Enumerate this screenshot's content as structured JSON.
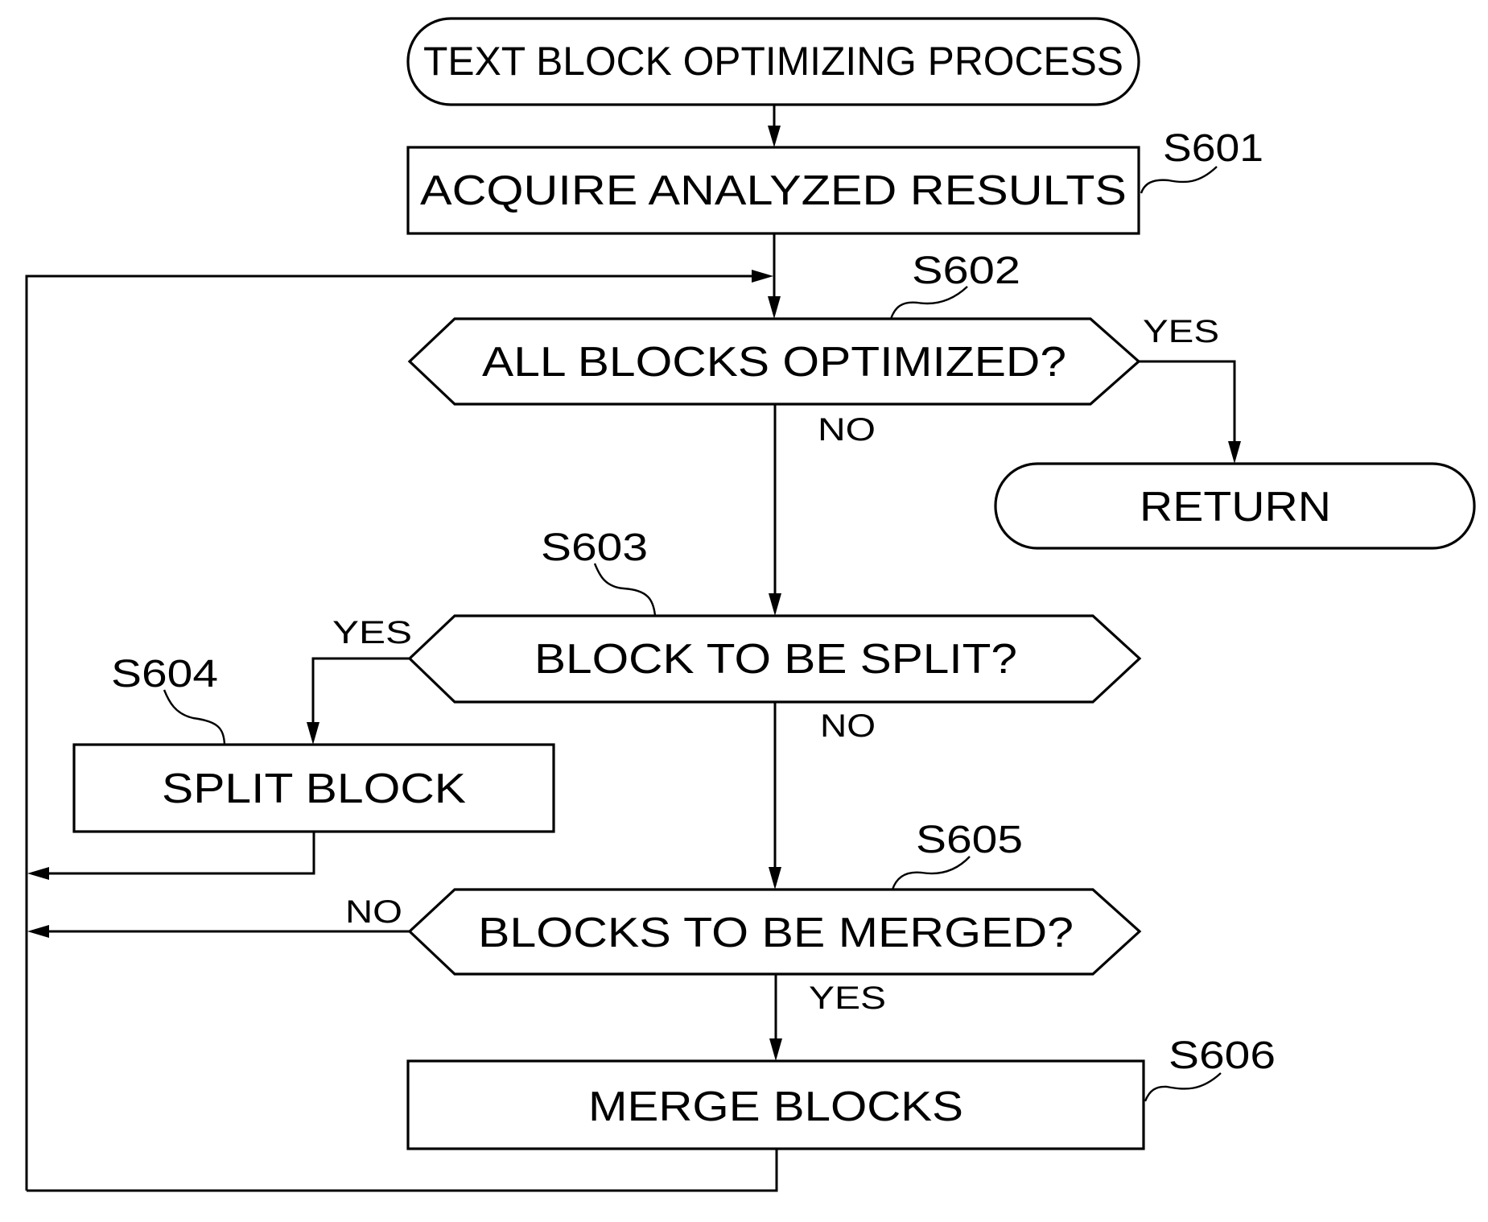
{
  "figure": {
    "title": "TEXT BLOCK OPTIMIZING PROCESS",
    "stroke_color": "#000000",
    "background_color": "#ffffff"
  },
  "nodes": {
    "start": {
      "type": "terminator",
      "label": "TEXT BLOCK OPTIMIZING PROCESS"
    },
    "s601": {
      "type": "process",
      "step": "S601",
      "label": "ACQUIRE ANALYZED RESULTS"
    },
    "s602": {
      "type": "decision",
      "step": "S602",
      "label": "ALL BLOCKS OPTIMIZED?"
    },
    "ret": {
      "type": "terminator",
      "label": "RETURN"
    },
    "s603": {
      "type": "decision",
      "step": "S603",
      "label": "BLOCK TO BE SPLIT?"
    },
    "s604": {
      "type": "process",
      "step": "S604",
      "label": "SPLIT BLOCK"
    },
    "s605": {
      "type": "decision",
      "step": "S605",
      "label": "BLOCKS TO BE MERGED?"
    },
    "s606": {
      "type": "process",
      "step": "S606",
      "label": "MERGE BLOCKS"
    }
  },
  "branches": {
    "s602_yes": "YES",
    "s602_no": "NO",
    "s603_yes": "YES",
    "s603_no": "NO",
    "s605_no": "NO",
    "s605_yes": "YES"
  },
  "edges": [
    {
      "from": "start",
      "to": "s601"
    },
    {
      "from": "s601",
      "to": "s602"
    },
    {
      "from": "s602",
      "to": "ret",
      "label": "YES"
    },
    {
      "from": "s602",
      "to": "s603",
      "label": "NO"
    },
    {
      "from": "s603",
      "to": "s604",
      "label": "YES"
    },
    {
      "from": "s603",
      "to": "s605",
      "label": "NO"
    },
    {
      "from": "s604",
      "to": "s602",
      "label": ""
    },
    {
      "from": "s605",
      "to": "s602",
      "label": "NO"
    },
    {
      "from": "s605",
      "to": "s606",
      "label": "YES"
    },
    {
      "from": "s606",
      "to": "s602",
      "label": ""
    }
  ]
}
